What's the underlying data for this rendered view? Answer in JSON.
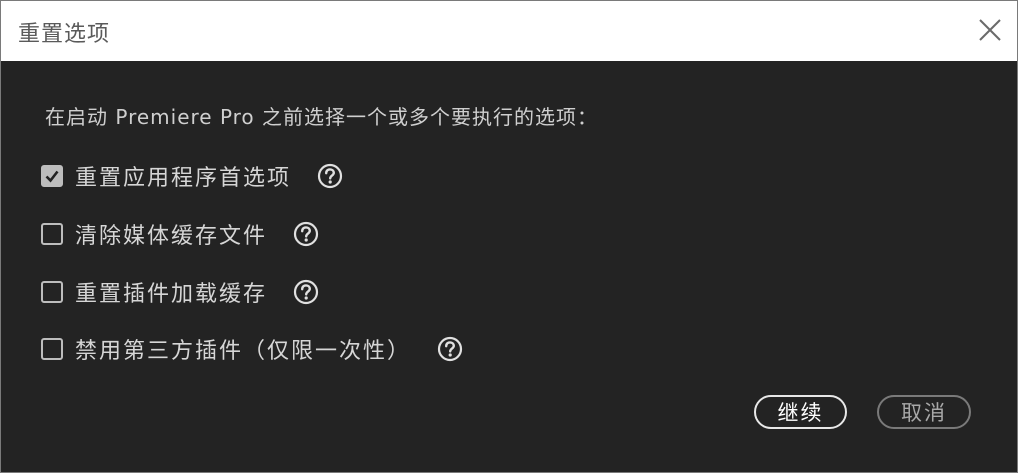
{
  "window": {
    "title": "重置选项"
  },
  "prompt": "在启动 Premiere Pro 之前选择一个或多个要执行的选项：",
  "options": [
    {
      "label": "重置应用程序首选项",
      "checked": true
    },
    {
      "label": "清除媒体缓存文件",
      "checked": false
    },
    {
      "label": "重置插件加载缓存",
      "checked": false
    },
    {
      "label": "禁用第三方插件（仅限一次性）",
      "checked": false
    }
  ],
  "buttons": {
    "continue_label": "继续",
    "cancel_label": "取消"
  },
  "icons": {
    "close": "close-icon",
    "help": "help-icon",
    "check": "checkmark-icon"
  }
}
